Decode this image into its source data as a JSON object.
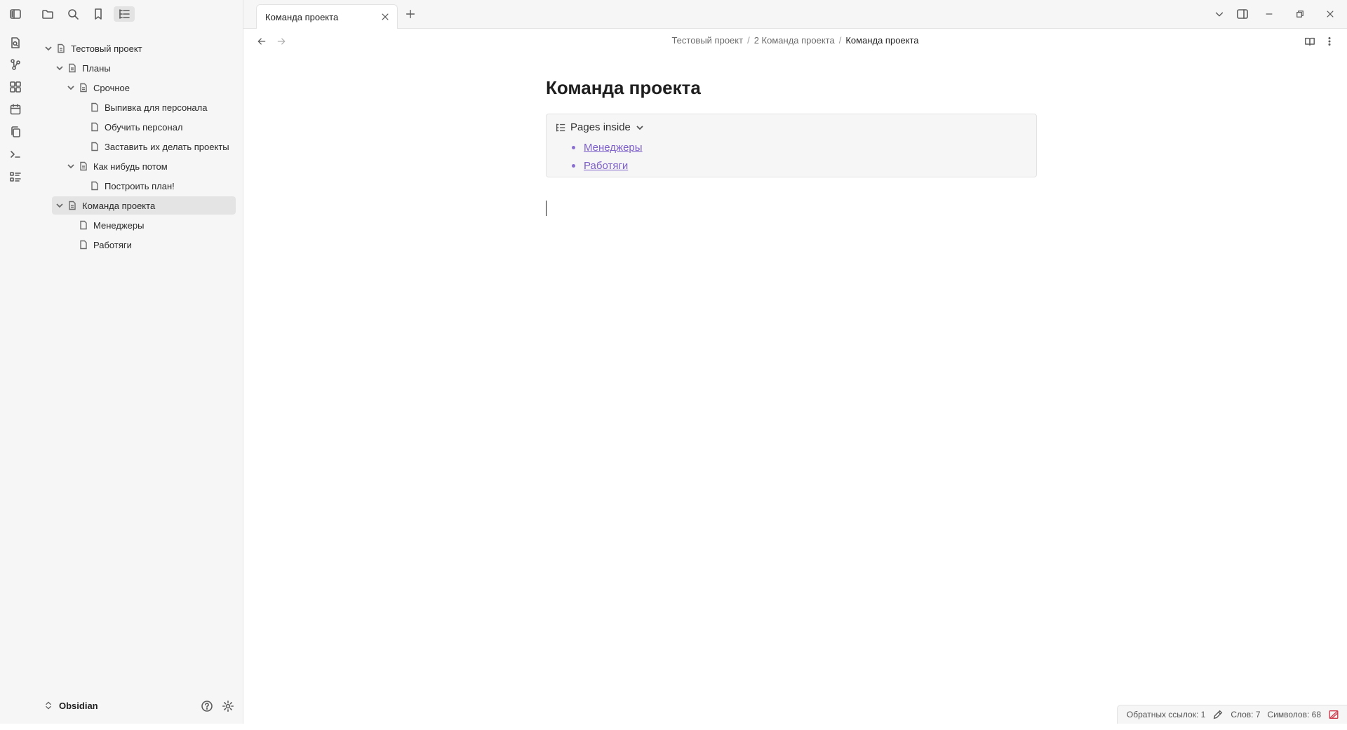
{
  "app": {
    "vault_name": "Obsidian"
  },
  "ribbon": {
    "items": [
      "toggle-sidebar-icon",
      "search-file-icon",
      "graph-icon",
      "canvas-icon",
      "calendar-icon",
      "copy-icon",
      "terminal-icon",
      "outline-icon"
    ]
  },
  "sidebar": {
    "toolbar": [
      "folder-icon",
      "search-icon",
      "bookmark-icon",
      "list-tree-icon"
    ],
    "active_tool": "list-tree-icon",
    "tree": [
      {
        "label": "Тестовый проект",
        "expanded": true,
        "selected": false
      },
      {
        "label": "Планы",
        "expanded": true,
        "selected": false
      },
      {
        "label": "Срочное",
        "expanded": true,
        "selected": false
      },
      {
        "label": "Выпивка для персонала",
        "expanded": false,
        "selected": false
      },
      {
        "label": "Обучить персонал",
        "expanded": false,
        "selected": false
      },
      {
        "label": "Заставить их делать проекты",
        "expanded": false,
        "selected": false
      },
      {
        "label": "Как нибудь потом",
        "expanded": true,
        "selected": false
      },
      {
        "label": "Построить план!",
        "expanded": false,
        "selected": false
      },
      {
        "label": "Команда проекта",
        "expanded": true,
        "selected": true
      },
      {
        "label": "Менеджеры",
        "expanded": false,
        "selected": false
      },
      {
        "label": "Работяги",
        "expanded": false,
        "selected": false
      }
    ]
  },
  "tabs": [
    {
      "title": "Команда проекта",
      "active": true
    }
  ],
  "breadcrumb": {
    "items": [
      "Тестовый проект",
      "2 Команда проекта"
    ],
    "current": "Команда проекта",
    "separator": "/"
  },
  "note": {
    "title": "Команда проекта",
    "pages_inside": {
      "label": "Pages inside",
      "items": [
        "Менеджеры",
        "Работяги"
      ]
    }
  },
  "status": {
    "backlinks": "Обратных ссылок: 1",
    "words": "Слов: 7",
    "chars": "Символов: 68"
  },
  "colors": {
    "accent": "#7c5fc9",
    "sync_error": "#d0374a",
    "selected": "#e4e4e4"
  }
}
